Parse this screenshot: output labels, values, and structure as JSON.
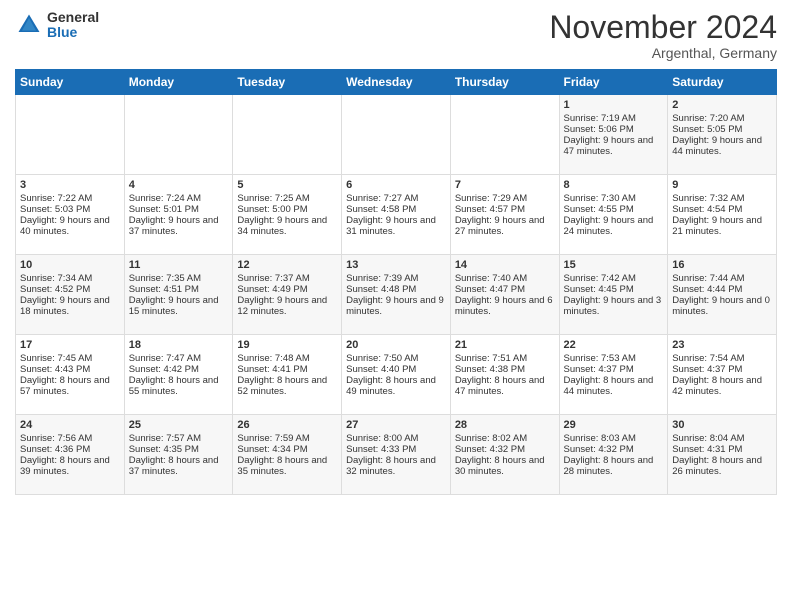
{
  "header": {
    "logo_general": "General",
    "logo_blue": "Blue",
    "month_title": "November 2024",
    "subtitle": "Argenthal, Germany"
  },
  "days_of_week": [
    "Sunday",
    "Monday",
    "Tuesday",
    "Wednesday",
    "Thursday",
    "Friday",
    "Saturday"
  ],
  "weeks": [
    [
      {
        "day": "",
        "info": ""
      },
      {
        "day": "",
        "info": ""
      },
      {
        "day": "",
        "info": ""
      },
      {
        "day": "",
        "info": ""
      },
      {
        "day": "",
        "info": ""
      },
      {
        "day": "1",
        "info": "Sunrise: 7:19 AM\nSunset: 5:06 PM\nDaylight: 9 hours and 47 minutes."
      },
      {
        "day": "2",
        "info": "Sunrise: 7:20 AM\nSunset: 5:05 PM\nDaylight: 9 hours and 44 minutes."
      }
    ],
    [
      {
        "day": "3",
        "info": "Sunrise: 7:22 AM\nSunset: 5:03 PM\nDaylight: 9 hours and 40 minutes."
      },
      {
        "day": "4",
        "info": "Sunrise: 7:24 AM\nSunset: 5:01 PM\nDaylight: 9 hours and 37 minutes."
      },
      {
        "day": "5",
        "info": "Sunrise: 7:25 AM\nSunset: 5:00 PM\nDaylight: 9 hours and 34 minutes."
      },
      {
        "day": "6",
        "info": "Sunrise: 7:27 AM\nSunset: 4:58 PM\nDaylight: 9 hours and 31 minutes."
      },
      {
        "day": "7",
        "info": "Sunrise: 7:29 AM\nSunset: 4:57 PM\nDaylight: 9 hours and 27 minutes."
      },
      {
        "day": "8",
        "info": "Sunrise: 7:30 AM\nSunset: 4:55 PM\nDaylight: 9 hours and 24 minutes."
      },
      {
        "day": "9",
        "info": "Sunrise: 7:32 AM\nSunset: 4:54 PM\nDaylight: 9 hours and 21 minutes."
      }
    ],
    [
      {
        "day": "10",
        "info": "Sunrise: 7:34 AM\nSunset: 4:52 PM\nDaylight: 9 hours and 18 minutes."
      },
      {
        "day": "11",
        "info": "Sunrise: 7:35 AM\nSunset: 4:51 PM\nDaylight: 9 hours and 15 minutes."
      },
      {
        "day": "12",
        "info": "Sunrise: 7:37 AM\nSunset: 4:49 PM\nDaylight: 9 hours and 12 minutes."
      },
      {
        "day": "13",
        "info": "Sunrise: 7:39 AM\nSunset: 4:48 PM\nDaylight: 9 hours and 9 minutes."
      },
      {
        "day": "14",
        "info": "Sunrise: 7:40 AM\nSunset: 4:47 PM\nDaylight: 9 hours and 6 minutes."
      },
      {
        "day": "15",
        "info": "Sunrise: 7:42 AM\nSunset: 4:45 PM\nDaylight: 9 hours and 3 minutes."
      },
      {
        "day": "16",
        "info": "Sunrise: 7:44 AM\nSunset: 4:44 PM\nDaylight: 9 hours and 0 minutes."
      }
    ],
    [
      {
        "day": "17",
        "info": "Sunrise: 7:45 AM\nSunset: 4:43 PM\nDaylight: 8 hours and 57 minutes."
      },
      {
        "day": "18",
        "info": "Sunrise: 7:47 AM\nSunset: 4:42 PM\nDaylight: 8 hours and 55 minutes."
      },
      {
        "day": "19",
        "info": "Sunrise: 7:48 AM\nSunset: 4:41 PM\nDaylight: 8 hours and 52 minutes."
      },
      {
        "day": "20",
        "info": "Sunrise: 7:50 AM\nSunset: 4:40 PM\nDaylight: 8 hours and 49 minutes."
      },
      {
        "day": "21",
        "info": "Sunrise: 7:51 AM\nSunset: 4:38 PM\nDaylight: 8 hours and 47 minutes."
      },
      {
        "day": "22",
        "info": "Sunrise: 7:53 AM\nSunset: 4:37 PM\nDaylight: 8 hours and 44 minutes."
      },
      {
        "day": "23",
        "info": "Sunrise: 7:54 AM\nSunset: 4:37 PM\nDaylight: 8 hours and 42 minutes."
      }
    ],
    [
      {
        "day": "24",
        "info": "Sunrise: 7:56 AM\nSunset: 4:36 PM\nDaylight: 8 hours and 39 minutes."
      },
      {
        "day": "25",
        "info": "Sunrise: 7:57 AM\nSunset: 4:35 PM\nDaylight: 8 hours and 37 minutes."
      },
      {
        "day": "26",
        "info": "Sunrise: 7:59 AM\nSunset: 4:34 PM\nDaylight: 8 hours and 35 minutes."
      },
      {
        "day": "27",
        "info": "Sunrise: 8:00 AM\nSunset: 4:33 PM\nDaylight: 8 hours and 32 minutes."
      },
      {
        "day": "28",
        "info": "Sunrise: 8:02 AM\nSunset: 4:32 PM\nDaylight: 8 hours and 30 minutes."
      },
      {
        "day": "29",
        "info": "Sunrise: 8:03 AM\nSunset: 4:32 PM\nDaylight: 8 hours and 28 minutes."
      },
      {
        "day": "30",
        "info": "Sunrise: 8:04 AM\nSunset: 4:31 PM\nDaylight: 8 hours and 26 minutes."
      }
    ]
  ]
}
